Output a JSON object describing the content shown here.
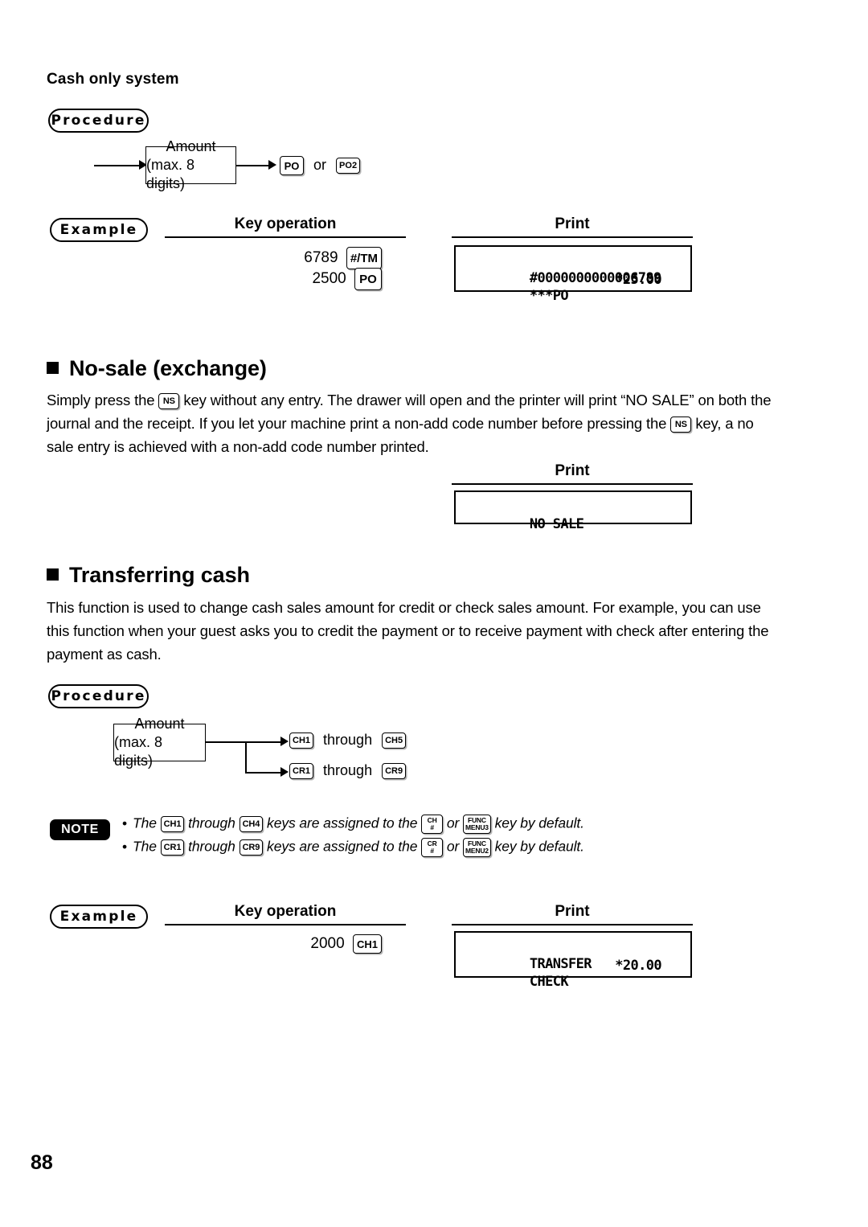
{
  "page": {
    "number": "88"
  },
  "cash_only": {
    "heading": "Cash only system",
    "procedure_label": "Procedure",
    "flow": {
      "box_line1": "Amount",
      "box_line2": "(max. 8 digits)",
      "key_po": "PO",
      "or_text": "or",
      "key_po2": "PO2"
    },
    "example_label": "Example",
    "col_key_operation": "Key operation",
    "col_print": "Print",
    "key_operation": [
      {
        "number": "6789",
        "key": "#/TM"
      },
      {
        "number": "2500",
        "key": "PO"
      }
    ],
    "print": {
      "line1_left": "#0000000000006789",
      "line1_right": "",
      "line2_left": "***PO",
      "line2_right": "*25.00"
    }
  },
  "no_sale": {
    "heading": "No-sale (exchange)",
    "paragraph_part1": "Simply press the",
    "key_ns_1": "NS",
    "paragraph_part2": "key without any entry.  The drawer will open and the printer will print “NO SALE” on",
    "paragraph_part3": "both the journal and the receipt.  If you let your machine print a non-add code number before pressing the",
    "key_ns_2": "NS",
    "paragraph_part4": "key, a no sale entry is achieved with a non-add code number printed.",
    "col_print": "Print",
    "print": {
      "line1_left": "NO SALE",
      "line1_right": ""
    }
  },
  "transferring_cash": {
    "heading": "Transferring cash",
    "paragraph_line1": "This function is used to change cash sales amount for credit or check sales amount. For example, you can",
    "paragraph_line2": "use this function when your guest asks you to credit the payment or to receive payment with check after",
    "paragraph_line3": "entering the payment as cash.",
    "procedure_label": "Procedure",
    "flow": {
      "box_line1": "Amount",
      "box_line2": "(max. 8 digits)",
      "branch1_key_from": "CH1",
      "branch1_through": "through",
      "branch1_key_to": "CH5",
      "branch2_key_from": "CR1",
      "branch2_through": "through",
      "branch2_key_to": "CR9"
    },
    "note": {
      "badge": "NOTE",
      "line1": {
        "bullet": "•",
        "t1": "The",
        "k1": "CH1",
        "t2": "through",
        "k2": "CH4",
        "t3": "keys are assigned to the",
        "k3_top": "CH",
        "k3_bottom": "#",
        "t4": "or",
        "k4_top": "FUNC",
        "k4_bottom": "MENU3",
        "t5": "key by default."
      },
      "line2": {
        "bullet": "•",
        "t1": "The",
        "k1": "CR1",
        "t2": "through",
        "k2": "CR9",
        "t3": "keys are assigned to the",
        "k3_top": "CR",
        "k3_bottom": "#",
        "t4": "or",
        "k4_top": "FUNC",
        "k4_bottom": "MENU2",
        "t5": "key by default."
      }
    },
    "example_label": "Example",
    "col_key_operation": "Key operation",
    "col_print": "Print",
    "key_operation": [
      {
        "number": "2000",
        "key": "CH1"
      }
    ],
    "print": {
      "line1_left": "TRANSFER",
      "line1_right": "",
      "line2_left": "CHECK",
      "line2_right": "*20.00"
    }
  }
}
